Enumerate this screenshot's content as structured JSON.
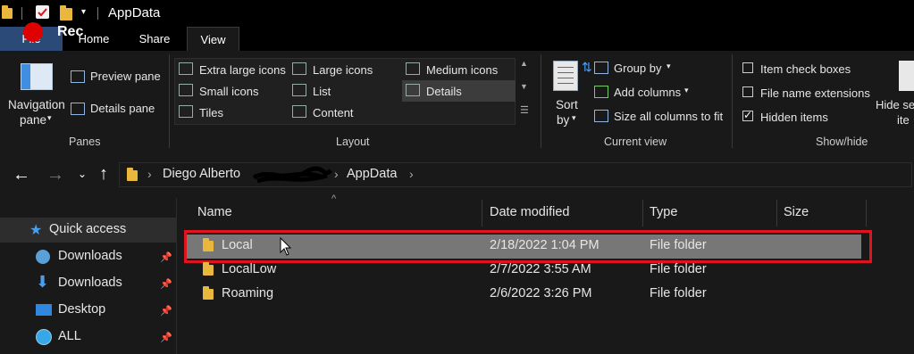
{
  "window": {
    "title": "AppData"
  },
  "recording": {
    "label": "Rec"
  },
  "tabs": [
    {
      "label": "File"
    },
    {
      "label": "Home"
    },
    {
      "label": "Share"
    },
    {
      "label": "View"
    }
  ],
  "ribbon": {
    "panes": {
      "navigation_pane": "Navigation",
      "navigation_pane_2": "pane",
      "preview_pane": "Preview pane",
      "details_pane": "Details pane",
      "group": "Panes"
    },
    "layout": {
      "extra_large_icons": "Extra large icons",
      "large_icons": "Large icons",
      "medium_icons": "Medium icons",
      "small_icons": "Small icons",
      "list": "List",
      "details": "Details",
      "tiles": "Tiles",
      "content": "Content",
      "group": "Layout"
    },
    "current_view": {
      "sort": "Sort",
      "sort_2": "by",
      "group_by": "Group by",
      "add_columns": "Add columns",
      "size_all_columns": "Size all columns to fit",
      "group": "Current view"
    },
    "show_hide": {
      "item_check_boxes": "Item check boxes",
      "item_check_boxes_checked": false,
      "file_name_extensions": "File name extensions",
      "file_name_extensions_checked": false,
      "hidden_items": "Hidden items",
      "hidden_items_checked": true,
      "hide_selected": "Hide se",
      "hide_selected_2": "ite",
      "group": "Show/hide"
    }
  },
  "address": {
    "crumbs": [
      "Diego Alberto",
      "AppData"
    ]
  },
  "sidebar": {
    "items": [
      {
        "label": "Quick access",
        "icon": "star-icon",
        "pinned": false
      },
      {
        "label": "Downloads",
        "icon": "globe-icon",
        "pinned": true
      },
      {
        "label": "Downloads",
        "icon": "download-arrow-icon",
        "pinned": true
      },
      {
        "label": "Desktop",
        "icon": "desktop-icon",
        "pinned": true
      },
      {
        "label": "ALL",
        "icon": "disc-icon",
        "pinned": true
      }
    ]
  },
  "columns": {
    "name": "Name",
    "date_modified": "Date modified",
    "type": "Type",
    "size": "Size"
  },
  "files": [
    {
      "name": "Local",
      "date": "2/18/2022 1:04 PM",
      "type": "File folder",
      "selected": true
    },
    {
      "name": "LocalLow",
      "date": "2/7/2022 3:55 AM",
      "type": "File folder",
      "selected": false
    },
    {
      "name": "Roaming",
      "date": "2/6/2022 3:26 PM",
      "type": "File folder",
      "selected": false
    }
  ],
  "colors": {
    "background": "#191919",
    "selection": "#777777",
    "highlight_box": "#e0141e",
    "folder": "#e8b73b",
    "accent_blue": "#4a9eef"
  }
}
